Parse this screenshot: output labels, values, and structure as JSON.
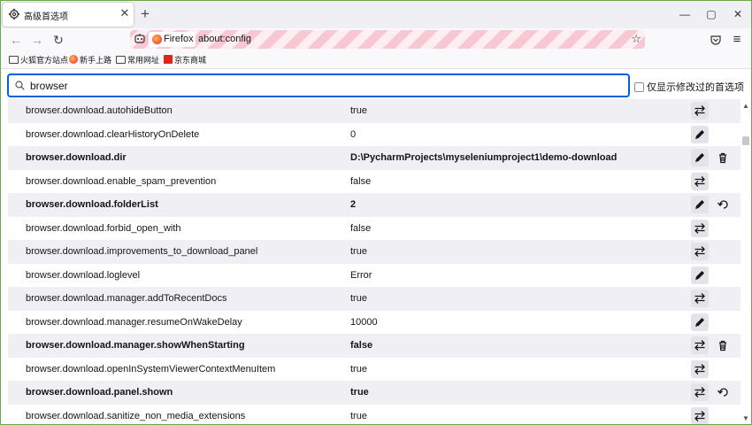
{
  "tab": {
    "title": "高级首选项",
    "close": "✕",
    "new_tab": "+"
  },
  "window_controls": {
    "minimize": "—",
    "maximize": "▢",
    "close": "✕"
  },
  "nav": {
    "back": "←",
    "forward": "→",
    "reload": "↻"
  },
  "urlbar": {
    "identity_label": "Firefox",
    "url": "about:config",
    "star": "☆"
  },
  "toolbar_right": {
    "pocket": "⌂",
    "menu": "≡"
  },
  "bookmarks": [
    {
      "label": "火狐官方站点",
      "icon": "folder-icon"
    },
    {
      "label": "新手上路",
      "icon": "firefox-icon"
    },
    {
      "label": "常用网址",
      "icon": "folder-icon"
    },
    {
      "label": "京东商城",
      "icon": "jd-icon"
    }
  ],
  "search": {
    "value": "browser",
    "placeholder": ""
  },
  "modified_only_label": "仅显示修改过的首选项",
  "prefs": [
    {
      "name": "browser.download.autohideButton",
      "value": "true",
      "modified": false,
      "action": "toggle",
      "extra": ""
    },
    {
      "name": "browser.download.clearHistoryOnDelete",
      "value": "0",
      "modified": false,
      "action": "edit",
      "extra": ""
    },
    {
      "name": "browser.download.dir",
      "value": "D:\\PycharmProjects\\myseleniumproject1\\demo-download",
      "modified": true,
      "action": "edit",
      "extra": "delete"
    },
    {
      "name": "browser.download.enable_spam_prevention",
      "value": "false",
      "modified": false,
      "action": "toggle",
      "extra": ""
    },
    {
      "name": "browser.download.folderList",
      "value": "2",
      "modified": true,
      "action": "edit",
      "extra": "reset"
    },
    {
      "name": "browser.download.forbid_open_with",
      "value": "false",
      "modified": false,
      "action": "toggle",
      "extra": ""
    },
    {
      "name": "browser.download.improvements_to_download_panel",
      "value": "true",
      "modified": false,
      "action": "toggle",
      "extra": ""
    },
    {
      "name": "browser.download.loglevel",
      "value": "Error",
      "modified": false,
      "action": "edit",
      "extra": ""
    },
    {
      "name": "browser.download.manager.addToRecentDocs",
      "value": "true",
      "modified": false,
      "action": "toggle",
      "extra": ""
    },
    {
      "name": "browser.download.manager.resumeOnWakeDelay",
      "value": "10000",
      "modified": false,
      "action": "edit",
      "extra": ""
    },
    {
      "name": "browser.download.manager.showWhenStarting",
      "value": "false",
      "modified": true,
      "action": "toggle",
      "extra": "delete"
    },
    {
      "name": "browser.download.openInSystemViewerContextMenuItem",
      "value": "true",
      "modified": false,
      "action": "toggle",
      "extra": ""
    },
    {
      "name": "browser.download.panel.shown",
      "value": "true",
      "modified": true,
      "action": "toggle",
      "extra": "reset"
    },
    {
      "name": "browser.download.sanitize_non_media_extensions",
      "value": "true",
      "modified": false,
      "action": "toggle",
      "extra": ""
    }
  ]
}
